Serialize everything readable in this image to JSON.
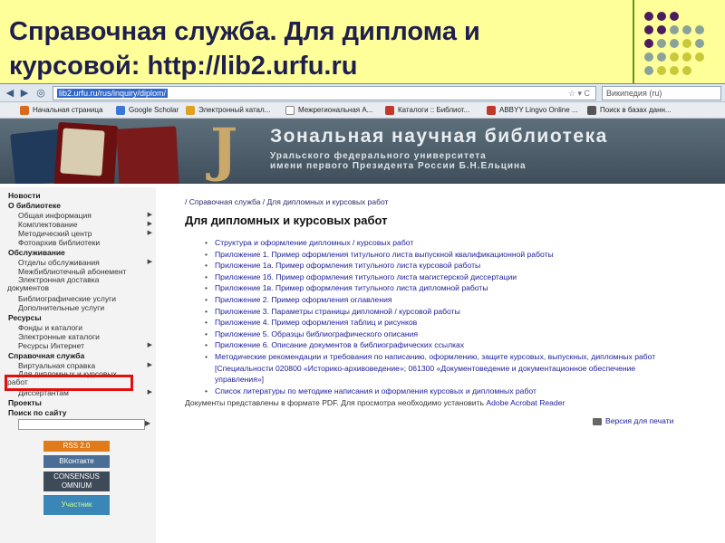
{
  "slide": {
    "title": "Справочная служба. Для диплома и курсовой: http://lib2.urfu.ru"
  },
  "browser": {
    "url": "lib2.urfu.ru/rus/inquiry/diplom/",
    "search_engine": "Википедия (ru)",
    "bookmarks": [
      {
        "label": "Начальная страница"
      },
      {
        "label": "Google Scholar"
      },
      {
        "label": "Электронный катал..."
      },
      {
        "label": "Межрегиональная А..."
      },
      {
        "label": "Каталоги :: Библиот..."
      },
      {
        "label": "ABBYY Lingvo Online ..."
      },
      {
        "label": "Поиск в базах данн..."
      }
    ]
  },
  "banner": {
    "title": "Зональная научная библиотека",
    "subtitle_line1": "Уральского федерального университета",
    "subtitle_line2": "имени первого Президента России Б.Н.Ельцина"
  },
  "nav": {
    "news": "Новости",
    "about": "О библиотеке",
    "about_items": [
      "Общая информация",
      "Комплектование",
      "Методический центр",
      "Фотоархив библиотеки"
    ],
    "service": "Обслуживание",
    "service_items": [
      "Отделы обслуживания",
      "Межбиблиотечный абонемент",
      "Электронная доставка документов",
      "Библиографические услуги",
      "Дополнительные услуги"
    ],
    "resources": "Ресурсы",
    "resources_items": [
      "Фонды и каталоги",
      "Электронные каталоги",
      "Ресурсы Интернет"
    ],
    "reference": "Справочная служба",
    "reference_items": [
      "Виртуальная справка",
      "Для дипломных и курсовых работ",
      "Диссертантам"
    ],
    "projects": "Проекты",
    "site_search": "Поиск по сайту",
    "badges": [
      "RSS 2.0",
      "ВКонтакте",
      "CONSENSUS OMNIUM",
      "Участник"
    ]
  },
  "content": {
    "breadcrumb": "/ Справочная служба / Для дипломных и курсовых работ",
    "heading": "Для дипломных и курсовых работ",
    "links": [
      "Структура и оформление дипломных / курсовых работ",
      "Приложение 1. Пример оформления титульного листа выпускной квалификационной работы",
      "Приложение 1а. Пример оформления титульного листа курсовой работы",
      "Приложение 1б. Пример оформления титульного листа магистерской диссертации",
      "Приложение 1в. Пример оформления титульного листа дипломной работы",
      "Приложение 2. Пример оформления оглавления",
      "Приложение 3. Параметры страницы дипломной / курсовой работы",
      "Приложение 4. Пример оформления таблиц и рисунков",
      "Приложение 5. Образцы библиографического описания",
      "Приложение 6. Описание документов в библиографических ссылках",
      "Методические рекомендации и требования по написанию, оформлению, защите курсовых, выпускных, дипломных работ [Специальности 020800 «Историко-архивоведение»; 061300 «Документоведение и документационное обеспечение управления»]",
      "Список литературы по методике написания и оформления курсовых и дипломных работ"
    ],
    "note_prefix": "Документы представлены в формате PDF. Для просмотра необходимо установить",
    "note_link": "Adobe Acrobat Reader",
    "print_label": "Версия для печати"
  }
}
